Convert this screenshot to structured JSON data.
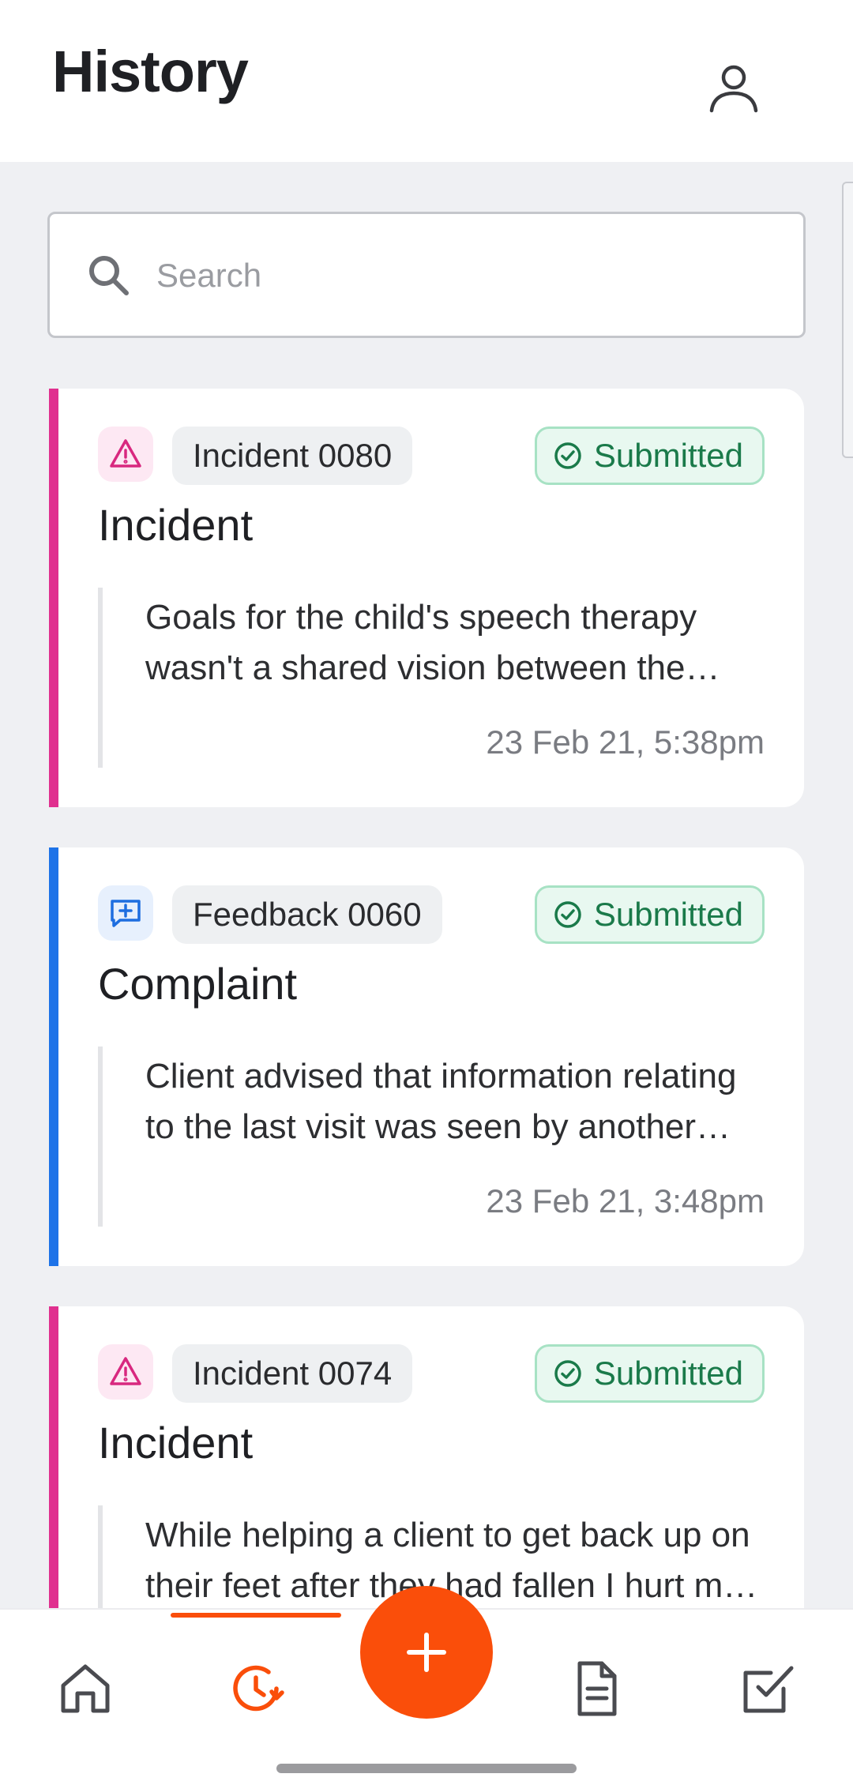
{
  "header": {
    "title": "History",
    "profile_icon": "user-icon"
  },
  "search": {
    "placeholder": "Search",
    "value": "",
    "icon": "search-icon"
  },
  "cards": [
    {
      "category": "incident",
      "accent": "#e0308f",
      "icon": "warning-triangle-icon",
      "reference": "Incident 0080",
      "status": "Submitted",
      "title": "Incident",
      "excerpt": "Goals for the child's speech therapy wasn't a shared vision between the parents and the therapist.",
      "timestamp": "23 Feb 21, 5:38pm"
    },
    {
      "category": "feedback",
      "accent": "#1e73e8",
      "icon": "message-plus-icon",
      "reference": "Feedback 0060",
      "status": "Submitted",
      "title": "Complaint",
      "excerpt": "Client advised that information relating to the last visit was seen by another person.",
      "timestamp": "23 Feb 21, 3:48pm"
    },
    {
      "category": "incident",
      "accent": "#e0308f",
      "icon": "warning-triangle-icon",
      "reference": "Incident 0074",
      "status": "Submitted",
      "title": "Incident",
      "excerpt": "While helping a client to get back up on their feet after they had fallen I hurt my back.",
      "timestamp": ""
    }
  ],
  "bottom_nav": {
    "active": "history",
    "accent": "#fa4e0a",
    "items": [
      {
        "id": "home",
        "icon": "home-icon"
      },
      {
        "id": "history",
        "icon": "history-clock-icon"
      },
      {
        "id": "add",
        "icon": "plus-icon"
      },
      {
        "id": "documents",
        "icon": "document-icon"
      },
      {
        "id": "tasks",
        "icon": "checkbox-icon"
      }
    ]
  }
}
